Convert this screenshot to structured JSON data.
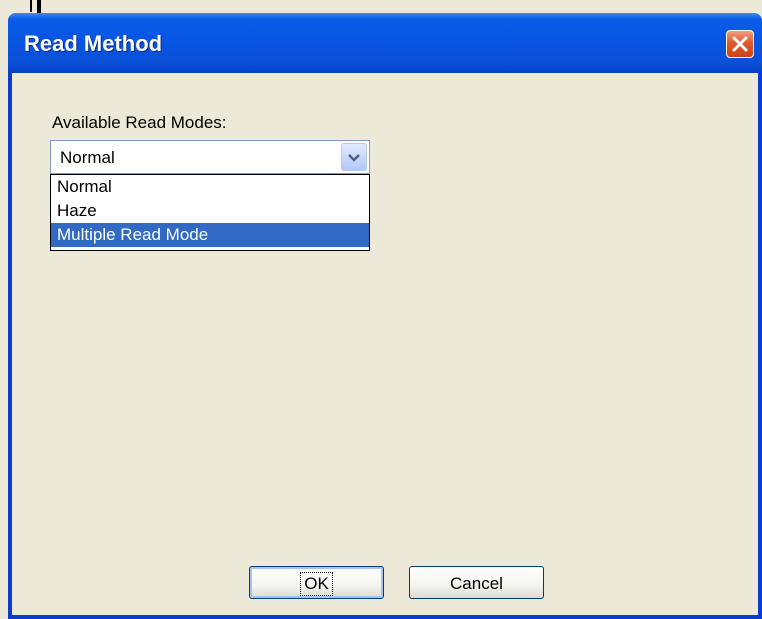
{
  "dialog": {
    "title": "Read Method",
    "close_icon": "close-icon"
  },
  "read_modes": {
    "label": "Available Read Modes:",
    "selected_value": "Normal",
    "options": [
      "Normal",
      "Haze",
      "Multiple Read Mode"
    ],
    "highlighted_option": "Multiple Read Mode"
  },
  "buttons": {
    "ok_label": "OK",
    "cancel_label": "Cancel"
  },
  "colors": {
    "titlebar": "#0a5de7",
    "dialog_bg": "#ece9d8",
    "highlight": "#316ac5",
    "close_button": "#e2582a"
  }
}
